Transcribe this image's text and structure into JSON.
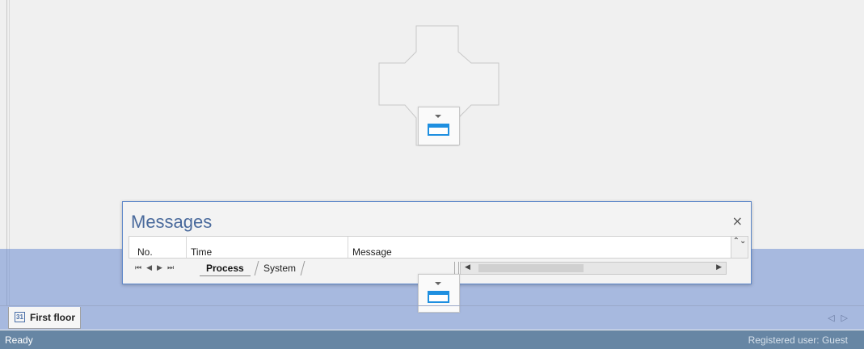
{
  "messages_panel": {
    "title": "Messages",
    "close_glyph": "×",
    "columns": [
      "No.",
      "Time",
      "Message"
    ],
    "grid_scroll_glyph": "⌃⌄",
    "nav_glyphs": "⏮◀▶⏭",
    "tabs": [
      {
        "label": "Process",
        "active": true
      },
      {
        "label": "System",
        "active": false
      }
    ]
  },
  "floor_tabs": [
    {
      "label": "First floor",
      "icon": "floor-plan-icon",
      "icon_glyph": "31"
    }
  ],
  "strip_nav_glyphs": "◁▷",
  "status_bar": {
    "left": "Ready",
    "right": "Registered user: Guest"
  },
  "colors": {
    "dock_highlight": "#6c8cd2",
    "accent_blue": "#1e8fe0",
    "status_bar": "#6786a4",
    "panel_border": "#5d87c9"
  },
  "icons": {
    "dock_target": "dock-bottom-icon",
    "close": "close-icon",
    "tab_nav": "tab-navigation-icon"
  }
}
